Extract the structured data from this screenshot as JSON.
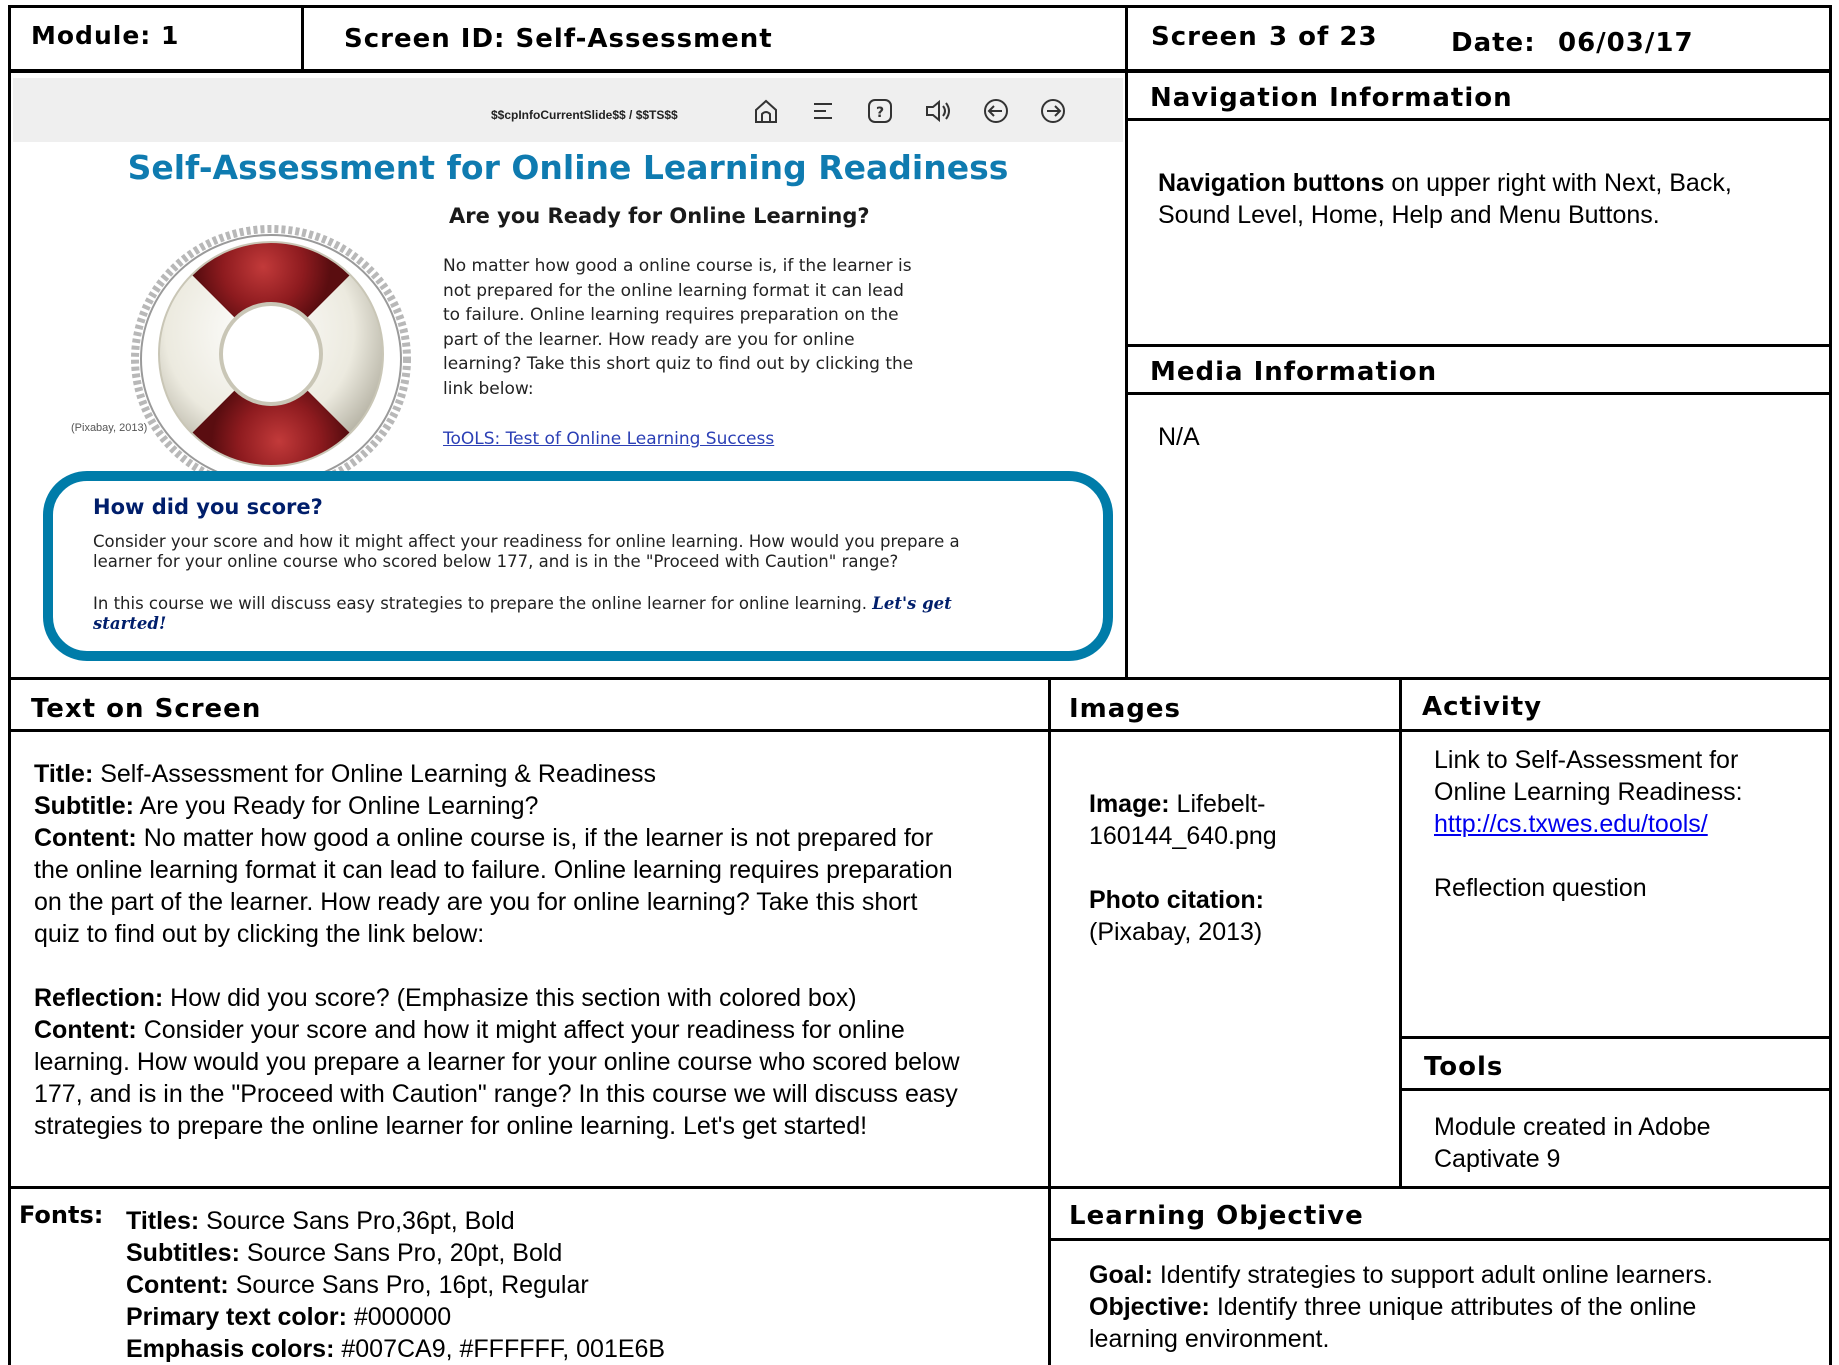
{
  "header": {
    "module": "Module: 1",
    "screen_id": "Screen ID: Self-Assessment",
    "screen_label": "Screen",
    "screen_num": "3 of 23",
    "date_label": "Date:",
    "date_value": "06/03/17"
  },
  "slide": {
    "counter": "$$cpInfoCurrentSlide$$ / $$TS$$",
    "toolbar_icons": [
      "home-icon",
      "menu-icon",
      "help-icon",
      "sound-icon",
      "back-icon",
      "next-icon"
    ],
    "title": "Self-Assessment for Online Learning Readiness",
    "subtitle": "Are you Ready for Online Learning?",
    "paragraph_lines": [
      "No matter how good a online course is, if the learner is",
      "not prepared for the online learning format it can lead",
      "to failure. Online learning requires preparation on the",
      "part of the learner. How ready are you for online",
      "learning? Take this short quiz to find out by clicking the",
      "link below:"
    ],
    "link": "ToOLS: Test of Online Learning Success",
    "image_citation": "(Pixabay, 2013)",
    "score_title": "How did you score?",
    "score_p1_lines": [
      "Consider your score and how it might affect your readiness for online learning. How would you prepare a",
      "learner for your online course who scored below 177, and is in the \"Proceed with Caution\" range?"
    ],
    "score_p2_text": "In this course we will discuss easy strategies to prepare the online learner for online learning.",
    "score_p2_em_1": "Let's get",
    "score_p2_em_2": "started!",
    "colors": {
      "title": "#0f7bb0",
      "box_border": "#007CA9",
      "emphasis": "#001E6B",
      "ring_red": "#8e1b1f"
    }
  },
  "navigation": {
    "title": "Navigation Information",
    "bold": "Navigation buttons",
    "text_1": " on upper right with Next, Back,",
    "text_2": "Sound Level, Home, Help and Menu Buttons."
  },
  "media": {
    "title": "Media Information",
    "text": "N/A"
  },
  "text_on_screen": {
    "title": "Text on Screen",
    "title_label": "Title:",
    "title_value": " Self-Assessment for Online Learning & Readiness",
    "subtitle_label": "Subtitle:",
    "subtitle_value": " Are you Ready for Online Learning?",
    "content_label": "Content:",
    "content_line1": " No matter how good a online course is, if the learner is not prepared for",
    "content_lines": [
      "the online learning format it can lead to failure. Online learning requires preparation",
      "on the part of the learner. How ready are you for online learning? Take this short",
      "quiz to find out by clicking the link below:"
    ],
    "reflection_label": "Reflection:",
    "reflection_value": " How did you score? (Emphasize this section with colored box)",
    "content2_label": "Content:",
    "content2_line1": " Consider your score and how it might affect your readiness for online",
    "content2_lines": [
      "learning. How would you prepare a learner for your online course who scored below",
      "177, and is in the \"Proceed with Caution\" range? In this course we will discuss easy",
      "strategies to prepare the online learner for online learning. Let's get started!"
    ]
  },
  "images": {
    "title": "Images",
    "image_label": "Image:",
    "image_value_1": " Lifebelt-",
    "image_value_2": "160144_640.png",
    "citation_label": "Photo citation:",
    "citation_value": "(Pixabay, 2013)"
  },
  "activity": {
    "title": "Activity",
    "line1": "Link to Self-Assessment for",
    "line2": "Online Learning Readiness:",
    "link": "http://cs.txwes.edu/tools/",
    "reflection": "Reflection question"
  },
  "tools": {
    "title": "Tools",
    "line1": "Module created in Adobe",
    "line2": "Captivate 9"
  },
  "fonts": {
    "label": "Fonts:",
    "rows": [
      {
        "label": "Titles:",
        "value": " Source Sans Pro,36pt, Bold"
      },
      {
        "label": "Subtitles:",
        "value": " Source Sans Pro, 20pt, Bold"
      },
      {
        "label": "Content:",
        "value": " Source Sans Pro, 16pt, Regular"
      },
      {
        "label": "Primary text color:",
        "value": " #000000"
      },
      {
        "label": "Emphasis colors:",
        "value": " #007CA9, #FFFFFF, 001E6B"
      }
    ]
  },
  "learning_objective": {
    "title": "Learning Objective",
    "goal_label": "Goal:",
    "goal_value": " Identify strategies to support adult online learners.",
    "objective_label": "Objective:",
    "objective_value_1": " Identify three unique attributes of the online",
    "objective_value_2": "learning environment."
  }
}
